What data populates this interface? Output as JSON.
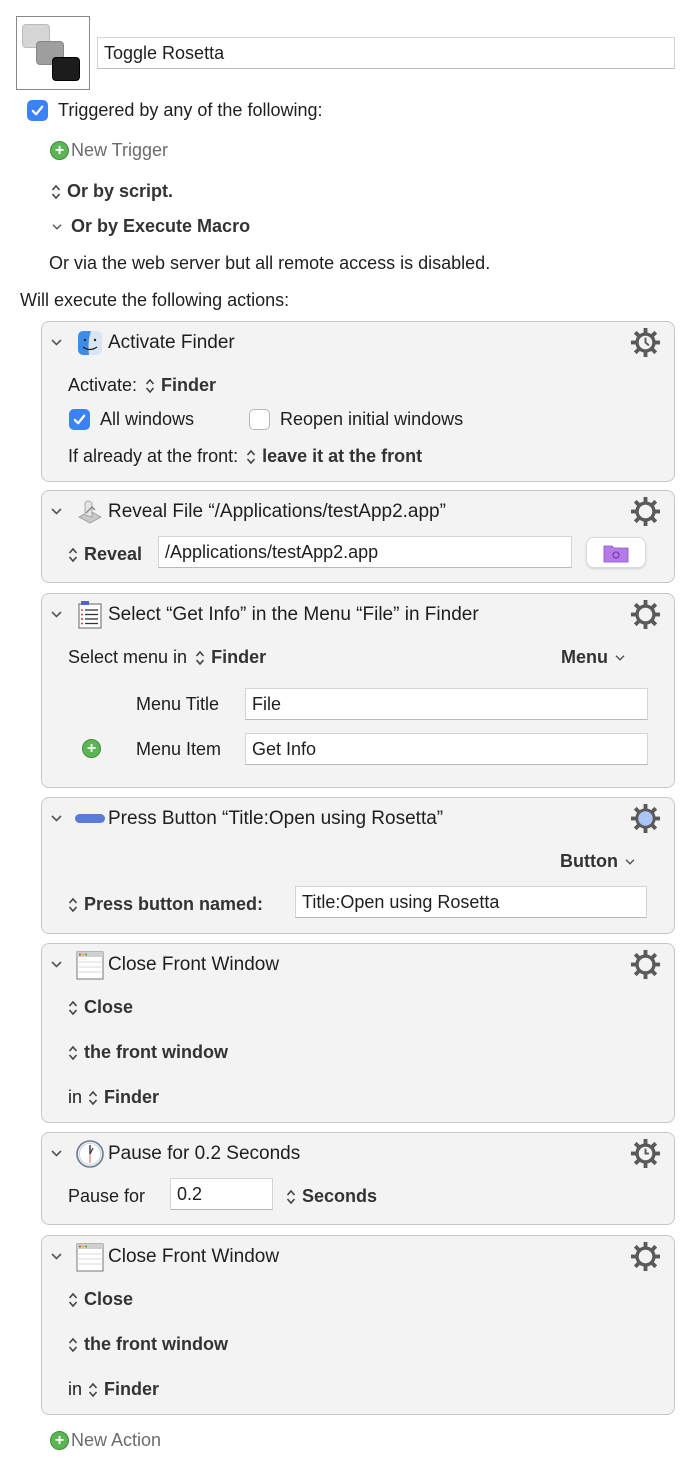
{
  "macro": {
    "name": "Toggle Rosetta",
    "icon": "keys-icon"
  },
  "triggers": {
    "enabled": true,
    "header": "Triggered by any of the following:",
    "new_trigger": "New Trigger",
    "or_by_script": "Or by script.",
    "or_by_execute_macro": "Or by Execute Macro",
    "web_server_note": "Or via the web server but all remote access is disabled."
  },
  "actions_header": "Will execute the following actions:",
  "actions": [
    {
      "title": "Activate Finder",
      "icon": "finder-icon",
      "gear": "gear-clock-icon",
      "activate_label": "Activate:",
      "activate_app": "Finder",
      "all_windows_label": "All windows",
      "all_windows": true,
      "reopen_label": "Reopen initial windows",
      "reopen": false,
      "if_front_label": "If already at the front:",
      "if_front_value": "leave it at the front"
    },
    {
      "title": "Reveal File “/Applications/testApp2.app”",
      "icon": "reveal-file-icon",
      "gear": "gear-icon",
      "mode": "Reveal",
      "path": "/Applications/testApp2.app",
      "folder_button": "folder-icon"
    },
    {
      "title": "Select “Get Info” in the Menu “File” in Finder",
      "icon": "menu-list-icon",
      "gear": "gear-icon",
      "select_label": "Select menu in",
      "app": "Finder",
      "type_menu": "Menu",
      "menu_title_label": "Menu Title",
      "menu_title": "File",
      "menu_item_label": "Menu Item",
      "menu_item": "Get Info"
    },
    {
      "title": "Press Button “Title:Open using Rosetta”",
      "icon": "button-icon",
      "gear": "gear-active-icon",
      "type_menu": "Button",
      "press_label": "Press button named:",
      "button_name": "Title:Open using Rosetta"
    },
    {
      "title": "Close Front Window",
      "icon": "window-icon",
      "gear": "gear-icon",
      "action": "Close",
      "target": "the front window",
      "in_label": "in",
      "app": "Finder"
    },
    {
      "title": "Pause for 0.2 Seconds",
      "icon": "clock-icon",
      "gear": "gear-clock-icon",
      "pause_label": "Pause for",
      "value": "0.2",
      "unit": "Seconds"
    },
    {
      "title": "Close Front Window",
      "icon": "window-icon",
      "gear": "gear-icon",
      "action": "Close",
      "target": "the front window",
      "in_label": "in",
      "app": "Finder"
    }
  ],
  "new_action": "New Action",
  "colors": {
    "accent_blue": "#3a82f6",
    "add_green": "#5cb555",
    "folder_purple": "#b57be8",
    "card_bg": "#f3f3f3"
  }
}
